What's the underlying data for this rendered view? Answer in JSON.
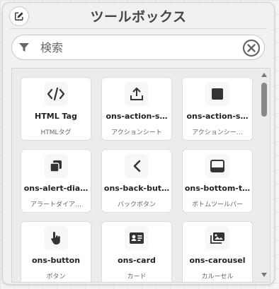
{
  "header": {
    "title": "ツールボックス",
    "edit_icon": "pencil-square-icon"
  },
  "search": {
    "placeholder": "検索",
    "value": ""
  },
  "cards": [
    {
      "name": "HTML Tag",
      "sub": "HTMLタグ",
      "icon": "code-icon"
    },
    {
      "name": "ons-action-s…",
      "sub": "アクションシート",
      "icon": "upload-icon"
    },
    {
      "name": "ons-action-s…",
      "sub": "アクションシー…",
      "icon": "square-icon"
    },
    {
      "name": "ons-alert-dia…",
      "sub": "アラートダイア…",
      "icon": "copy-icon"
    },
    {
      "name": "ons-back-but…",
      "sub": "バックボタン",
      "icon": "chevron-left-icon"
    },
    {
      "name": "ons-bottom-t…",
      "sub": "ボトムツールバー",
      "icon": "bottom-toolbar-icon"
    },
    {
      "name": "ons-button",
      "sub": "ボタン",
      "icon": "pointer-hand-icon"
    },
    {
      "name": "ons-card",
      "sub": "カード",
      "icon": "id-card-icon"
    },
    {
      "name": "ons-carousel",
      "sub": "カルーセル",
      "icon": "images-icon"
    }
  ]
}
